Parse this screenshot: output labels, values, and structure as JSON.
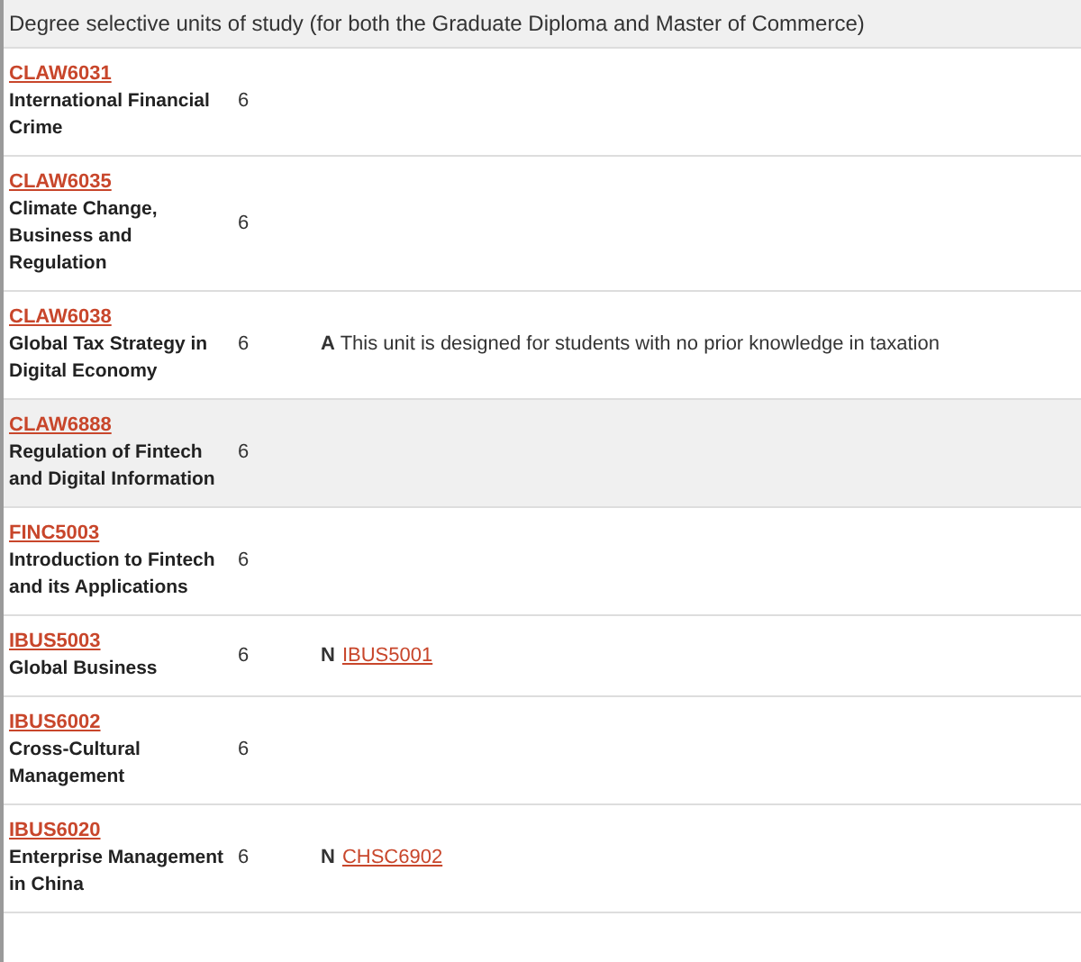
{
  "table": {
    "heading": "Degree selective units of study (for both the Graduate Diploma and Master of Commerce)",
    "rows": [
      {
        "code": "CLAW6031",
        "name": "International Financial Crime",
        "credit": "6",
        "highlighted": false
      },
      {
        "code": "CLAW6035",
        "name": "Climate Change, Business and Regulation",
        "credit": "6",
        "highlighted": false
      },
      {
        "code": "CLAW6038",
        "name": "Global Tax Strategy in Digital Economy",
        "credit": "6",
        "highlighted": false,
        "note": {
          "kind": "text",
          "label": "A",
          "text": "This unit is designed for students with no prior knowledge in taxation"
        }
      },
      {
        "code": "CLAW6888",
        "name": "Regulation of Fintech and Digital Information",
        "credit": "6",
        "highlighted": true
      },
      {
        "code": "FINC5003",
        "name": "Introduction to Fintech and its Applications",
        "credit": "6",
        "highlighted": false
      },
      {
        "code": "IBUS5003",
        "name": "Global Business",
        "credit": "6",
        "highlighted": false,
        "note": {
          "kind": "link",
          "label": "N",
          "link": "IBUS5001"
        }
      },
      {
        "code": "IBUS6002",
        "name": "Cross-Cultural Management",
        "credit": "6",
        "highlighted": false
      },
      {
        "code": "IBUS6020",
        "name": "Enterprise Management in China",
        "credit": "6",
        "highlighted": false,
        "note": {
          "kind": "link",
          "label": "N",
          "link": "CHSC6902"
        }
      }
    ]
  }
}
